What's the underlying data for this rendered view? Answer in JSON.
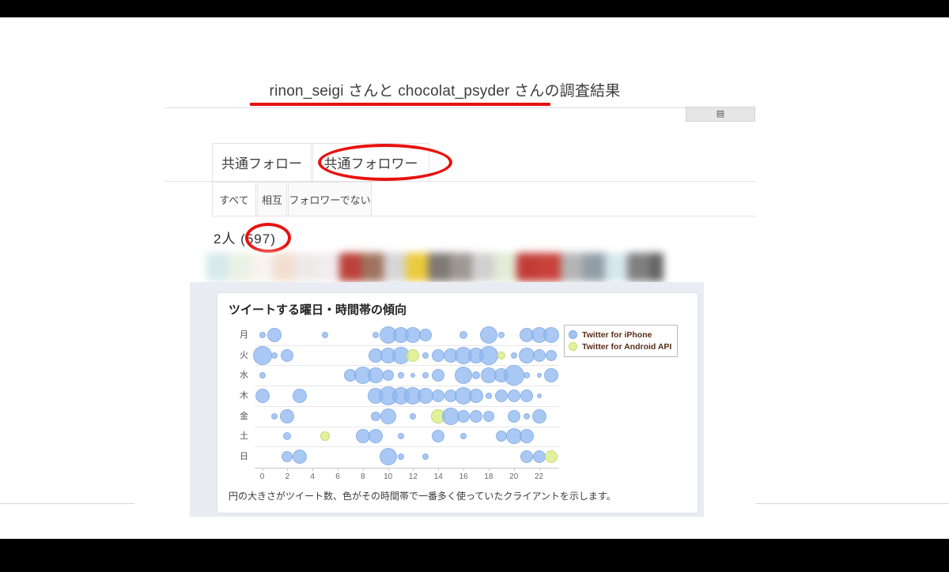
{
  "header": {
    "title": "rinon_seigi さんと chocolat_psyder さんの調査結果",
    "save_button_icon": "floppy-disk-icon",
    "save_button_glyph": "▤"
  },
  "main_tabs": [
    {
      "label": "共通フォロー",
      "selected": false
    },
    {
      "label": "共通フォロワー",
      "selected": true
    }
  ],
  "filter_tabs": [
    {
      "label": "すべて",
      "selected": true
    },
    {
      "label": "相互",
      "selected": false
    },
    {
      "label": "フォロワーでない",
      "selected": false
    }
  ],
  "count": {
    "text": "2人 (597)",
    "people": "2人",
    "total": "(597)"
  },
  "annotations": {
    "title_underline_color": "#e8120e",
    "tab_ellipse_color": "#e8120e",
    "count_ellipse_color": "#e8120e"
  },
  "chart_panel": {
    "title": "ツイートする曜日・時間帯の傾向",
    "caption": "円の大きさがツイート数、色がその時間帯で一番多く使っていたクライアントを示します。"
  },
  "chart_data": {
    "type": "scatter",
    "title": "ツイートする曜日・時間帯の傾向",
    "subtitle": "円の大きさがツイート数、色がその時間帯で一番多く使っていたクライアントを示します。",
    "xlabel": "",
    "ylabel": "",
    "xlim": [
      -0.6,
      23.6
    ],
    "grid": true,
    "legend_position": "right",
    "legend": [
      {
        "name": "Twitter for iPhone",
        "color": "#91b9f0"
      },
      {
        "name": "Twitter for Android API",
        "color": "#e2f398"
      }
    ],
    "xticks": [
      0,
      2,
      4,
      6,
      8,
      10,
      12,
      14,
      16,
      18,
      20,
      22
    ],
    "ylabels": [
      "月",
      "火",
      "水",
      "木",
      "金",
      "土",
      "日"
    ],
    "series": [
      {
        "name": "月",
        "points": [
          {
            "hour": 0,
            "size": 4,
            "client": "iphone"
          },
          {
            "hour": 1,
            "size": 9,
            "client": "iphone"
          },
          {
            "hour": 5,
            "size": 4,
            "client": "iphone"
          },
          {
            "hour": 9,
            "size": 4,
            "client": "iphone"
          },
          {
            "hour": 10,
            "size": 11,
            "client": "iphone"
          },
          {
            "hour": 11,
            "size": 10,
            "client": "iphone"
          },
          {
            "hour": 12,
            "size": 10,
            "client": "iphone"
          },
          {
            "hour": 13,
            "size": 8,
            "client": "iphone"
          },
          {
            "hour": 16,
            "size": 5,
            "client": "iphone"
          },
          {
            "hour": 18,
            "size": 11,
            "client": "iphone"
          },
          {
            "hour": 19,
            "size": 4,
            "client": "iphone"
          },
          {
            "hour": 21,
            "size": 9,
            "client": "iphone"
          },
          {
            "hour": 22,
            "size": 10,
            "client": "iphone"
          },
          {
            "hour": 23,
            "size": 10,
            "client": "iphone"
          }
        ]
      },
      {
        "name": "火",
        "points": [
          {
            "hour": 0,
            "size": 12,
            "client": "iphone"
          },
          {
            "hour": 1,
            "size": 4,
            "client": "iphone"
          },
          {
            "hour": 2,
            "size": 8,
            "client": "iphone"
          },
          {
            "hour": 9,
            "size": 9,
            "client": "iphone"
          },
          {
            "hour": 10,
            "size": 10,
            "client": "iphone"
          },
          {
            "hour": 11,
            "size": 11,
            "client": "iphone"
          },
          {
            "hour": 12,
            "size": 8,
            "client": "android"
          },
          {
            "hour": 13,
            "size": 4,
            "client": "iphone"
          },
          {
            "hour": 14,
            "size": 8,
            "client": "iphone"
          },
          {
            "hour": 15,
            "size": 9,
            "client": "iphone"
          },
          {
            "hour": 16,
            "size": 11,
            "client": "iphone"
          },
          {
            "hour": 17,
            "size": 10,
            "client": "iphone"
          },
          {
            "hour": 18,
            "size": 12,
            "client": "iphone"
          },
          {
            "hour": 19,
            "size": 5,
            "client": "android"
          },
          {
            "hour": 20,
            "size": 4,
            "client": "iphone"
          },
          {
            "hour": 21,
            "size": 10,
            "client": "iphone"
          },
          {
            "hour": 22,
            "size": 8,
            "client": "iphone"
          },
          {
            "hour": 23,
            "size": 7,
            "client": "iphone"
          }
        ]
      },
      {
        "name": "水",
        "points": [
          {
            "hour": 0,
            "size": 4,
            "client": "iphone"
          },
          {
            "hour": 7,
            "size": 8,
            "client": "iphone"
          },
          {
            "hour": 8,
            "size": 11,
            "client": "iphone"
          },
          {
            "hour": 9,
            "size": 10,
            "client": "iphone"
          },
          {
            "hour": 10,
            "size": 7,
            "client": "iphone"
          },
          {
            "hour": 11,
            "size": 4,
            "client": "iphone"
          },
          {
            "hour": 12,
            "size": 3,
            "client": "iphone"
          },
          {
            "hour": 13,
            "size": 4,
            "client": "iphone"
          },
          {
            "hour": 14,
            "size": 8,
            "client": "iphone"
          },
          {
            "hour": 16,
            "size": 11,
            "client": "iphone"
          },
          {
            "hour": 17,
            "size": 5,
            "client": "iphone"
          },
          {
            "hour": 18,
            "size": 10,
            "client": "iphone"
          },
          {
            "hour": 19,
            "size": 9,
            "client": "iphone"
          },
          {
            "hour": 20,
            "size": 13,
            "client": "iphone"
          },
          {
            "hour": 21,
            "size": 4,
            "client": "iphone"
          },
          {
            "hour": 22,
            "size": 3,
            "client": "iphone"
          },
          {
            "hour": 23,
            "size": 9,
            "client": "iphone"
          }
        ]
      },
      {
        "name": "木",
        "points": [
          {
            "hour": 0,
            "size": 9,
            "client": "iphone"
          },
          {
            "hour": 3,
            "size": 9,
            "client": "iphone"
          },
          {
            "hour": 9,
            "size": 10,
            "client": "iphone"
          },
          {
            "hour": 10,
            "size": 12,
            "client": "iphone"
          },
          {
            "hour": 11,
            "size": 11,
            "client": "iphone"
          },
          {
            "hour": 12,
            "size": 11,
            "client": "iphone"
          },
          {
            "hour": 13,
            "size": 10,
            "client": "iphone"
          },
          {
            "hour": 14,
            "size": 8,
            "client": "iphone"
          },
          {
            "hour": 15,
            "size": 8,
            "client": "iphone"
          },
          {
            "hour": 16,
            "size": 11,
            "client": "iphone"
          },
          {
            "hour": 17,
            "size": 9,
            "client": "iphone"
          },
          {
            "hour": 18,
            "size": 4,
            "client": "iphone"
          },
          {
            "hour": 19,
            "size": 8,
            "client": "iphone"
          },
          {
            "hour": 20,
            "size": 8,
            "client": "iphone"
          },
          {
            "hour": 21,
            "size": 8,
            "client": "iphone"
          },
          {
            "hour": 22,
            "size": 3,
            "client": "iphone"
          }
        ]
      },
      {
        "name": "金",
        "points": [
          {
            "hour": 1,
            "size": 4,
            "client": "iphone"
          },
          {
            "hour": 2,
            "size": 9,
            "client": "iphone"
          },
          {
            "hour": 9,
            "size": 6,
            "client": "iphone"
          },
          {
            "hour": 10,
            "size": 10,
            "client": "iphone"
          },
          {
            "hour": 12,
            "size": 4,
            "client": "iphone"
          },
          {
            "hour": 14,
            "size": 9,
            "client": "android"
          },
          {
            "hour": 15,
            "size": 11,
            "client": "iphone"
          },
          {
            "hour": 16,
            "size": 8,
            "client": "iphone"
          },
          {
            "hour": 17,
            "size": 8,
            "client": "iphone"
          },
          {
            "hour": 18,
            "size": 7,
            "client": "iphone"
          },
          {
            "hour": 20,
            "size": 8,
            "client": "iphone"
          },
          {
            "hour": 21,
            "size": 4,
            "client": "iphone"
          },
          {
            "hour": 22,
            "size": 9,
            "client": "iphone"
          }
        ]
      },
      {
        "name": "土",
        "points": [
          {
            "hour": 2,
            "size": 5,
            "client": "iphone"
          },
          {
            "hour": 5,
            "size": 6,
            "client": "android"
          },
          {
            "hour": 8,
            "size": 9,
            "client": "iphone"
          },
          {
            "hour": 9,
            "size": 9,
            "client": "iphone"
          },
          {
            "hour": 11,
            "size": 4,
            "client": "iphone"
          },
          {
            "hour": 14,
            "size": 8,
            "client": "iphone"
          },
          {
            "hour": 16,
            "size": 4,
            "client": "iphone"
          },
          {
            "hour": 19,
            "size": 7,
            "client": "iphone"
          },
          {
            "hour": 20,
            "size": 10,
            "client": "iphone"
          },
          {
            "hour": 21,
            "size": 9,
            "client": "iphone"
          }
        ]
      },
      {
        "name": "日",
        "points": [
          {
            "hour": 2,
            "size": 7,
            "client": "iphone"
          },
          {
            "hour": 3,
            "size": 9,
            "client": "iphone"
          },
          {
            "hour": 10,
            "size": 11,
            "client": "iphone"
          },
          {
            "hour": 11,
            "size": 4,
            "client": "iphone"
          },
          {
            "hour": 13,
            "size": 4,
            "client": "iphone"
          },
          {
            "hour": 21,
            "size": 8,
            "client": "iphone"
          },
          {
            "hour": 22,
            "size": 8,
            "client": "iphone"
          },
          {
            "hour": 23,
            "size": 8,
            "client": "android"
          }
        ]
      }
    ]
  },
  "avatar_strip": {
    "blurred": true,
    "colors": [
      "#cfe6e8",
      "#e8efe0",
      "#f6f1ea",
      "#f0d9c8",
      "#ece6e6",
      "#efe9ec",
      "#b02016",
      "#8f5b45",
      "#cfcfcf",
      "#e8c21c",
      "#6a625c",
      "#8d8781",
      "#c9c9c9",
      "#dfe8cf",
      "#b71b16",
      "#c02118",
      "#a8a8a8",
      "#7e8c99",
      "#cfe4ea",
      "#6a6a6a",
      "#4a4a4a"
    ]
  }
}
